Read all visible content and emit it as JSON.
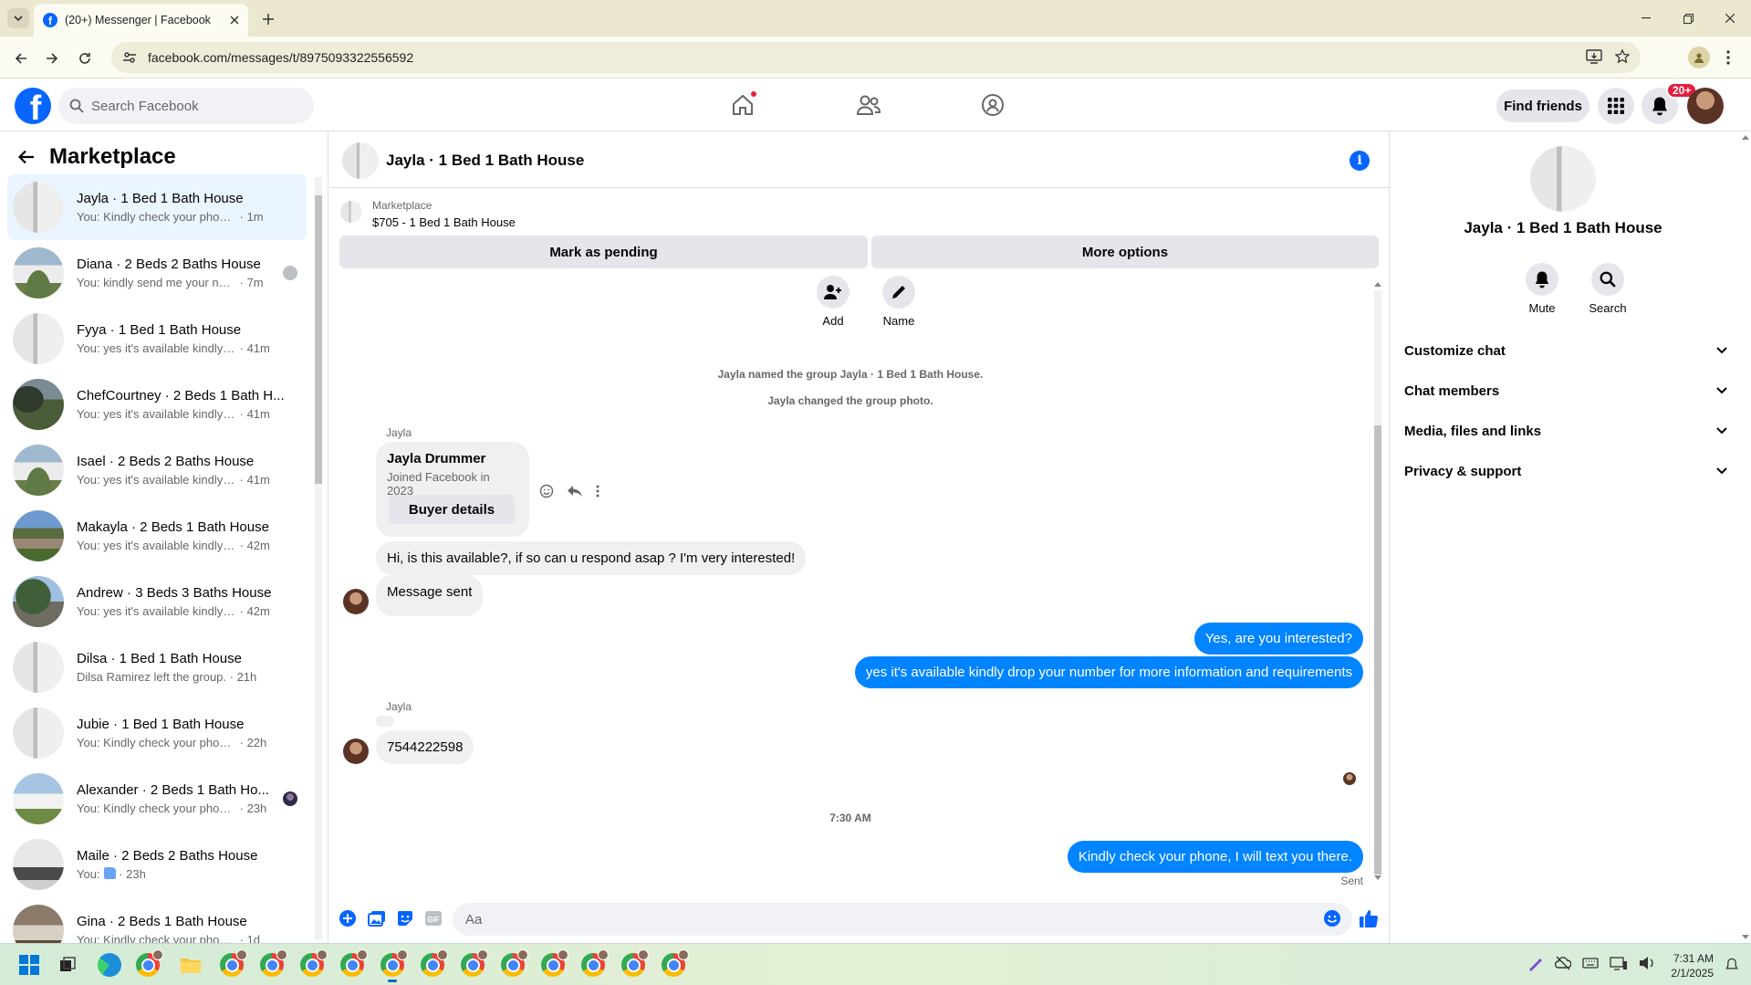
{
  "browser": {
    "tab_title": "(20+) Messenger | Facebook",
    "url": "facebook.com/messages/t/8975093322556592"
  },
  "fb": {
    "search_placeholder": "Search Facebook",
    "find_friends": "Find friends",
    "notif_badge": "20+"
  },
  "sidebar": {
    "title": "Marketplace",
    "conversations": [
      {
        "name": "Jayla · 1 Bed 1 Bath House",
        "snippet": "You: Kindly check your phone, I wi...",
        "time": "1m",
        "active": true
      },
      {
        "name": "Diana · 2 Beds 2 Baths House",
        "snippet": "You: kindly send me your numb...",
        "time": "7m"
      },
      {
        "name": "Fyya · 1 Bed 1 Bath House",
        "snippet": "You: yes it's available kindly drop...",
        "time": "41m"
      },
      {
        "name": "ChefCourtney · 2 Beds 1 Bath H...",
        "snippet": "You: yes it's available kindly drop...",
        "time": "41m"
      },
      {
        "name": "Isael · 2 Beds 2 Baths House",
        "snippet": "You: yes it's available kindly drop...",
        "time": "41m"
      },
      {
        "name": "Makayla · 2 Beds 1 Bath House",
        "snippet": "You: yes it's available kindly drop...",
        "time": "42m"
      },
      {
        "name": "Andrew · 3 Beds 3 Baths House",
        "snippet": "You: yes it's available kindly drop...",
        "time": "42m"
      },
      {
        "name": "Dilsa · 1 Bed 1 Bath House",
        "snippet": "Dilsa Ramirez left the group.",
        "time": "21h"
      },
      {
        "name": "Jubie · 1 Bed 1 Bath House",
        "snippet": "You: Kindly check your phone, I w...",
        "time": "22h"
      },
      {
        "name": "Alexander · 2 Beds 1 Bath Ho...",
        "snippet": "You: Kindly check your phone, I...",
        "time": "23h"
      },
      {
        "name": "Maile · 2 Beds 2 Baths House",
        "snippet": "You:",
        "time": "23h"
      },
      {
        "name": "Gina · 2 Beds 1 Bath House",
        "snippet": "You: Kindly check your phone, I will...",
        "time": "1d"
      }
    ]
  },
  "chat": {
    "title": "Jayla · 1 Bed 1 Bath House",
    "marketplace_label": "Marketplace",
    "listing": "$705 - 1 Bed 1 Bath House",
    "mark_pending": "Mark as pending",
    "more_options": "More options",
    "add_label": "Add",
    "name_label": "Name",
    "sys1": "Jayla named the group Jayla · 1 Bed 1 Bath House.",
    "sys2": "Jayla changed the group photo.",
    "sender1": "Jayla",
    "card_name": "Jayla Drummer",
    "card_joined": "Joined Facebook in 2023",
    "buyer_details": "Buyer details",
    "msg_in1": "Hi, is this available?, if so can u respond asap ? I'm very interested!",
    "msg_in2": "Message sent",
    "msg_out1": "Yes, are you interested?",
    "msg_out2": "yes it's available kindly drop your number for more information and requirements",
    "sender2": "Jayla",
    "msg_in3": "7544222598",
    "time": "7:30 AM",
    "msg_out3": "Kindly check your phone, I will text you there.",
    "sent": "Sent",
    "input_placeholder": "Aa"
  },
  "right": {
    "title": "Jayla · 1 Bed 1 Bath House",
    "mute": "Mute",
    "search": "Search",
    "sections": [
      "Customize chat",
      "Chat members",
      "Media, files and links",
      "Privacy & support"
    ]
  },
  "taskbar": {
    "time": "7:31 AM",
    "date": "2/1/2025"
  },
  "colors": {
    "fb_blue": "#0866ff",
    "bubble_out": "#0084ff",
    "badge_red": "#e41e3f"
  }
}
